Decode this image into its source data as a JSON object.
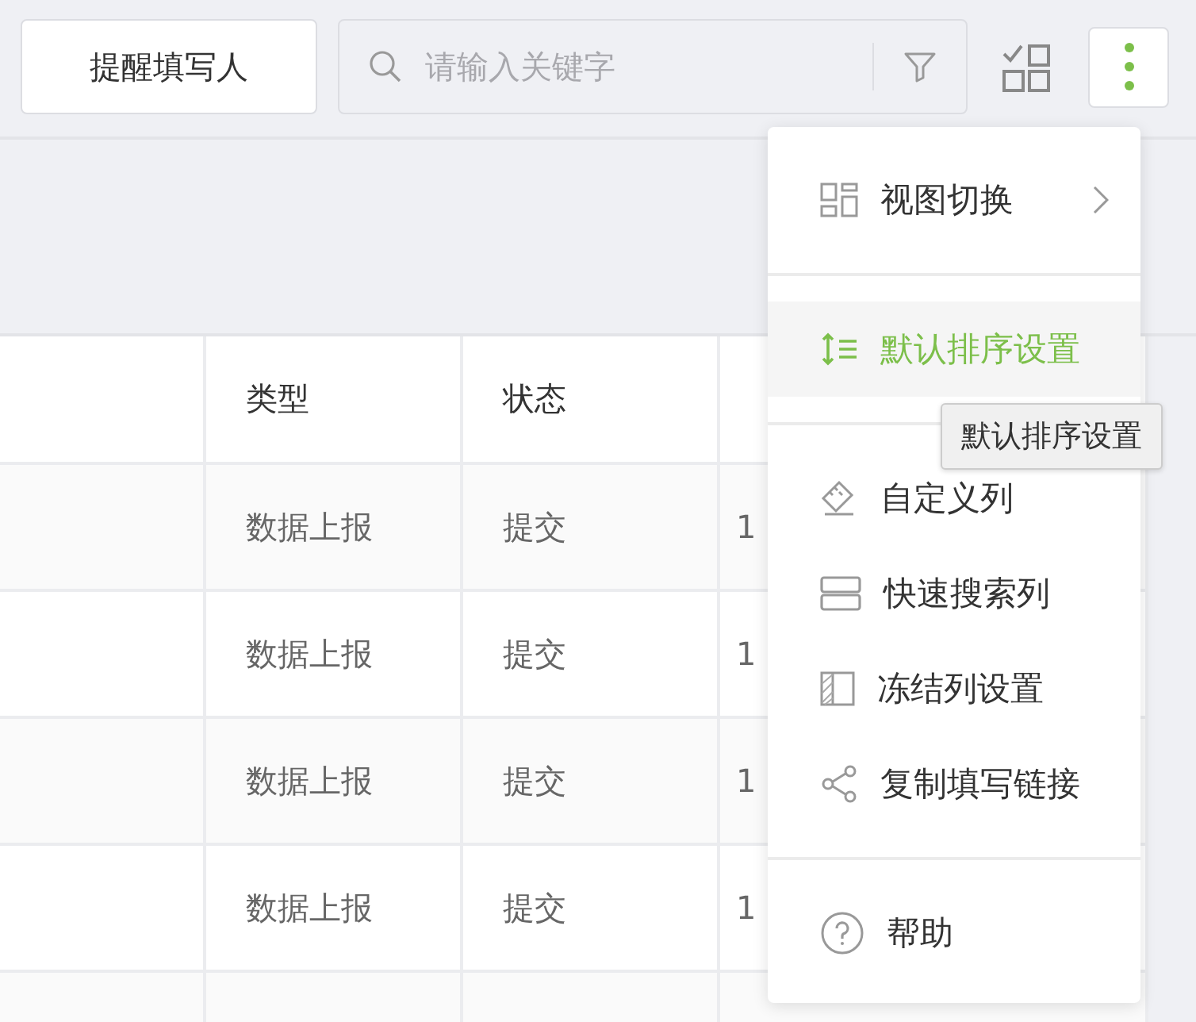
{
  "toolbar": {
    "remind_button": "提醒填写人",
    "search": {
      "placeholder": "请输入关键字"
    }
  },
  "table": {
    "columns": [
      "",
      "类型",
      "状态",
      ""
    ],
    "rows": [
      {
        "cells": [
          "",
          "数据上报",
          "提交",
          "1"
        ]
      },
      {
        "cells": [
          "",
          "数据上报",
          "提交",
          "1"
        ]
      },
      {
        "cells": [
          "",
          "数据上报",
          "提交",
          "1"
        ]
      },
      {
        "cells": [
          "",
          "数据上报",
          "提交",
          "1"
        ]
      },
      {
        "cells": [
          "",
          "",
          "",
          ""
        ]
      }
    ]
  },
  "menu": {
    "groups": [
      [
        {
          "label": "视图切换",
          "has_submenu": true,
          "selected": false
        }
      ],
      [
        {
          "label": "默认排序设置",
          "has_submenu": false,
          "selected": true
        }
      ],
      [
        {
          "label": "自定义列",
          "has_submenu": false,
          "selected": false
        },
        {
          "label": "快速搜索列",
          "has_submenu": false,
          "selected": false
        },
        {
          "label": "冻结列设置",
          "has_submenu": false,
          "selected": false
        },
        {
          "label": "复制填写链接",
          "has_submenu": false,
          "selected": false
        }
      ],
      [
        {
          "label": "帮助",
          "has_submenu": false,
          "selected": false
        }
      ]
    ]
  },
  "tooltip": {
    "text": "默认排序设置"
  }
}
